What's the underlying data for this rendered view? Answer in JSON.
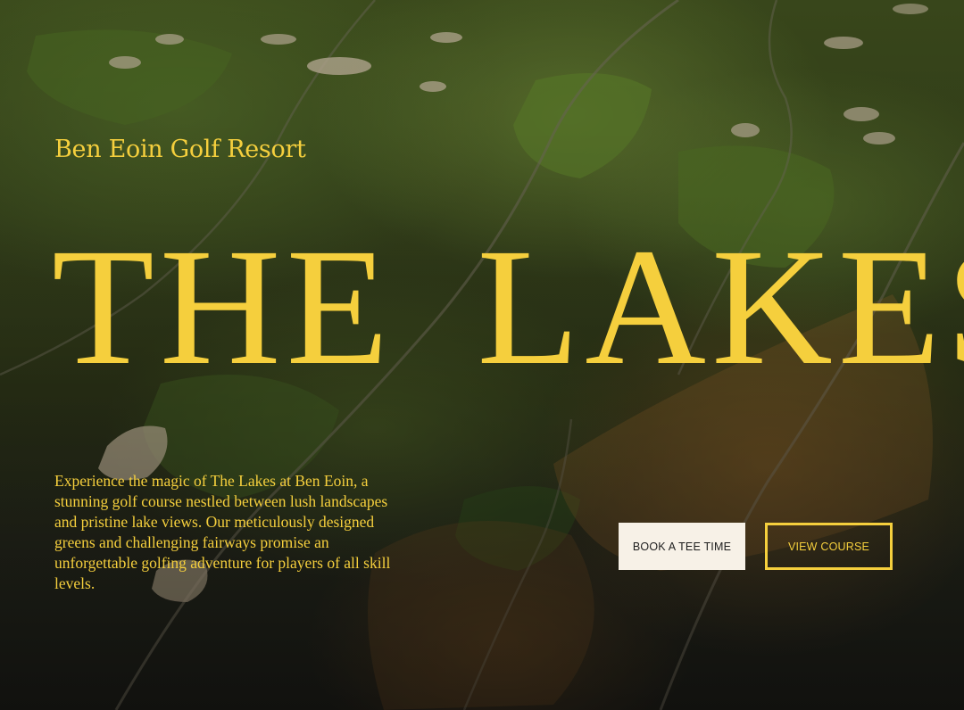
{
  "hero": {
    "eyebrow": "Ben Eoin Golf Resort",
    "headline": "THE LAKES",
    "description": "Experience the magic of The Lakes at Ben Eoin, a stunning golf course nestled between lush landscapes and pristine lake views. Our meticulously designed greens and challenging fairways promise an unforgettable golfing adventure for players of all skill levels."
  },
  "actions": {
    "book_label": "BOOK A TEE TIME",
    "view_label": "VIEW COURSE"
  },
  "colors": {
    "accent": "#f5cf3d",
    "button_light": "#f7f1e7",
    "fairway": "#3b4a1c"
  }
}
